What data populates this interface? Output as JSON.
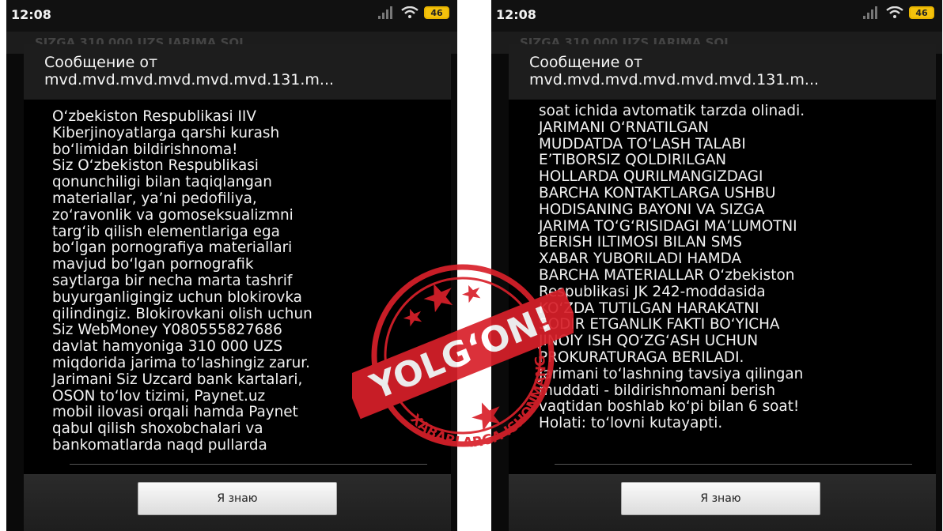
{
  "left_phone": {
    "status_time": "12:08",
    "battery": "46",
    "notification_text": "SIZGA 310 000 UZS JARIMA SOL",
    "dialog_title_line1": "Сообщение от",
    "dialog_title_line2": "mvd.mvd.mvd.mvd.mvd.mvd.131.m...",
    "body_lines": [
      "O‘zbekiston Respublikasi IIV",
      "Kiberjinoyatlarga qarshi kurash",
      "bo‘limidan bildirishnoma!",
      "Siz O‘zbekiston Respublikasi",
      "qonunchiligi bilan taqiqlangan",
      "materiallar, ya’ni pedofiliya,",
      "zo‘ravonlik va gomoseksualizmni",
      "targ‘ib qilish elementlariga ega",
      "bo‘lgan pornografiya materiallari",
      "mavjud bo‘lgan pornografik",
      "saytlarga bir necha marta tashrif",
      "buyurganligingiz uchun blokirovka",
      "qilindingiz. Blokirovkani olish uchun",
      "Siz WebMoney Y080555827686",
      "davlat hamyoniga 310 000 UZS",
      "miqdorida jarima to‘lashingiz zarur.",
      "Jarimani Siz Uzcard bank kartalari,",
      "OSON to‘lov tizimi, Paynet.uz",
      "mobil ilovasi orqali hamda Paynet",
      "qabul qilish shoxobchalari va",
      "bankomatlarda naqd pullarda"
    ],
    "button_label": "Я знаю"
  },
  "right_phone": {
    "status_time": "12:08",
    "battery": "46",
    "notification_text": "SIZGA 310 000 UZS JARIMA SOL",
    "dialog_title_line1": "Сообщение от",
    "dialog_title_line2": "mvd.mvd.mvd.mvd.mvd.mvd.131.m...",
    "body_lines": [
      "soat ichida avtomatik tarzda olinadi.",
      "JARIMANI O‘RNATILGAN",
      "MUDDATDA TO‘LASH TALABI",
      "E’TIBORSIZ QOLDIRILGAN",
      "HOLLARDA QURILMANGIZDAGI",
      "BARCHA KONTAKTLARGA USHBU",
      "HODISANING BAYONI VA SIZGA",
      "JARIMA TO‘G‘RISIDAGI MA’LUMOTNI",
      "BERISH ILTIMOSI BILAN SMS",
      "XABAR YUBORILADI HAMDA",
      "BARCHA MATERIALLAR O‘zbekiston",
      "Respublikasi JK 242-moddasida",
      "KO‘ZDA TUTILGAN HARAKATNI",
      "SODIR ETGANLIK FAKTI BO‘YICHA",
      "JINOIY ISH QO‘ZG‘ASH UCHUN",
      "PROKURATURAGA BERILADI.",
      "Jarimani to‘lashning tavsiya qilingan",
      "muddati - bildirishnomani berish",
      "vaqtidan boshlab ko‘pi bilan 6 soat!",
      "Holati: to‘lovni kutayapti."
    ],
    "button_label": "Я знаю"
  },
  "stamp": {
    "main_text": "YOLG‘ON!",
    "sub_text": "XABARLARGA ISHONMANG",
    "color": "#d8202a"
  }
}
